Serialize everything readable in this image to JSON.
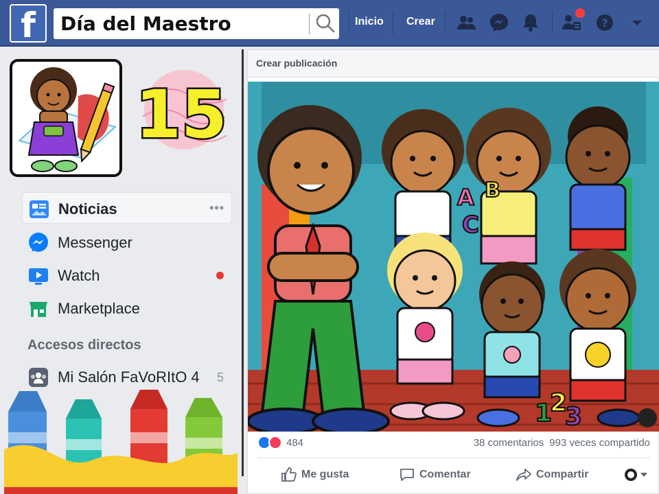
{
  "app": {
    "logo_letter": "f"
  },
  "search": {
    "value": "Día del Maestro"
  },
  "topnav": {
    "home": "Inicio",
    "create": "Crear"
  },
  "profile": {
    "day_number": "15"
  },
  "sidebar": {
    "items": [
      {
        "label": "Noticias",
        "icon": "news-feed-icon",
        "active": true,
        "more": "•••"
      },
      {
        "label": "Messenger",
        "icon": "messenger-icon"
      },
      {
        "label": "Watch",
        "icon": "watch-icon",
        "has_dot": true
      },
      {
        "label": "Marketplace",
        "icon": "marketplace-icon"
      }
    ],
    "shortcuts_title": "Accesos directos",
    "shortcuts": [
      {
        "label": "Mi Salón FaVoRItO 4",
        "count": "5",
        "icon": "group-icon"
      }
    ]
  },
  "post": {
    "header": "Crear publicación",
    "reactions_count": "484",
    "comments": "38 comentarios",
    "shares": "993 veces compartido",
    "actions": {
      "like": "Me gusta",
      "comment": "Comentar",
      "share": "Compartir"
    }
  },
  "colors": {
    "brand": "#3b5998",
    "like": "#1877f2",
    "love": "#f33e58"
  }
}
